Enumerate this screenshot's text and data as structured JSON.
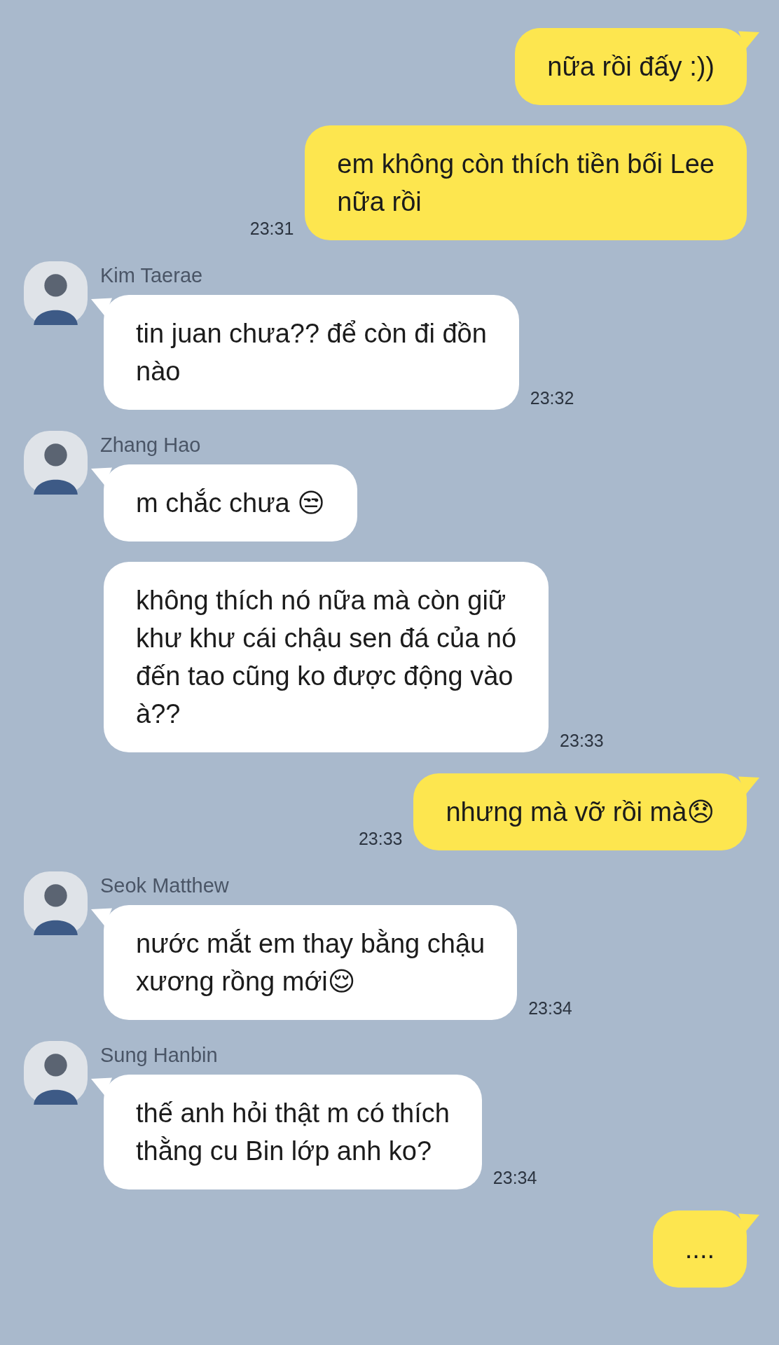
{
  "messages": [
    {
      "kind": "sent",
      "bubbles": [
        {
          "text": "nữa rồi đấy :))"
        },
        {
          "text": "em không còn thích tiền bối Lee\nnữa rồi",
          "time": "23:31"
        }
      ]
    },
    {
      "kind": "received",
      "sender": "Kim Taerae",
      "bubbles": [
        {
          "text": "tin juan chưa?? để còn đi đồn\nnào",
          "time": "23:32"
        }
      ]
    },
    {
      "kind": "received",
      "sender": "Zhang Hao",
      "bubbles": [
        {
          "text": "m chắc chưa 😒"
        },
        {
          "text": "không thích nó nữa mà còn giữ\nkhư khư cái chậu sen đá của nó\nđến tao cũng ko được động vào\nà??",
          "time": "23:33"
        }
      ]
    },
    {
      "kind": "sent",
      "bubbles": [
        {
          "text": "nhưng mà vỡ rồi mà😞",
          "time": "23:33"
        }
      ]
    },
    {
      "kind": "received",
      "sender": "Seok Matthew",
      "bubbles": [
        {
          "text": "nước mắt em thay bằng chậu\nxương rồng mới😌",
          "time": "23:34"
        }
      ]
    },
    {
      "kind": "received",
      "sender": "Sung Hanbin",
      "bubbles": [
        {
          "text": "thế anh hỏi thật m có thích\nthằng cu Bin lớp anh ko?",
          "time": "23:34"
        }
      ]
    },
    {
      "kind": "sent",
      "bubbles": [
        {
          "text": "...."
        }
      ]
    }
  ]
}
